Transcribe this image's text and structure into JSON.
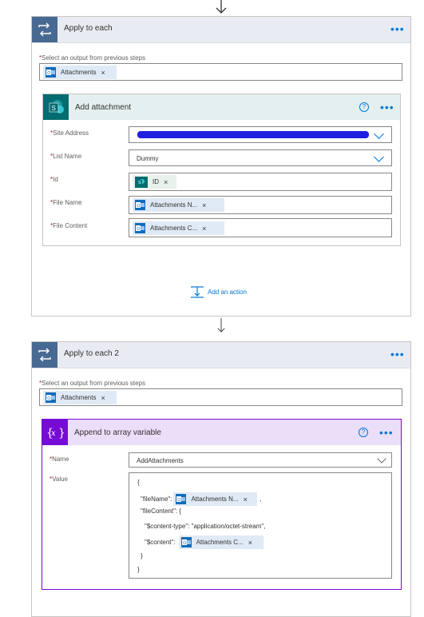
{
  "loop1": {
    "title": "Apply to each",
    "select_label": "Select an output from previous steps",
    "select_token": "Attachments",
    "action": {
      "title": "Add attachment",
      "fields": {
        "site_address": {
          "label": "Site Address",
          "value": ""
        },
        "list_name": {
          "label": "List Name",
          "value": "Dummy"
        },
        "id": {
          "label": "Id",
          "token": "ID"
        },
        "file_name": {
          "label": "File Name",
          "token": "Attachments N..."
        },
        "file_content": {
          "label": "File Content",
          "token": "Attachments C..."
        }
      }
    },
    "add_action": "Add an action"
  },
  "loop2": {
    "title": "Apply to each 2",
    "select_label": "Select an output from previous steps",
    "select_token": "Attachments",
    "action": {
      "title": "Append to array variable",
      "fields": {
        "name": {
          "label": "Name",
          "value": "AddAttachments"
        },
        "value": {
          "label": "Value"
        }
      },
      "json": {
        "open": "{",
        "file_name_key": "\"fileName\":",
        "file_name_token": "Attachments N...",
        "comma": ",",
        "file_content_key": "\"fileContent\": {",
        "content_type_line": "\"$content-type\": \"application/octet-stream\",",
        "content_key": "\"$content\":",
        "content_token": "Attachments C...",
        "inner_close": "}",
        "close": "}"
      }
    }
  },
  "icons": {
    "loop": "loop-icon",
    "outlook": "outlook-icon",
    "sharepoint": "sharepoint-icon",
    "variable": "variable-icon",
    "down_arrow": "down-arrow-icon",
    "add_action": "add-action-icon",
    "help": "help-icon",
    "more": "more-icon"
  },
  "colors": {
    "loop_header": "#e8ebf1",
    "loop_icon": "#486991",
    "sharepoint": "#036c70",
    "sharepoint_header": "#e3f0ef",
    "variable": "#770bd6",
    "variable_header": "#ebdef8",
    "accent": "#0078d4",
    "required": "#a4262c"
  }
}
